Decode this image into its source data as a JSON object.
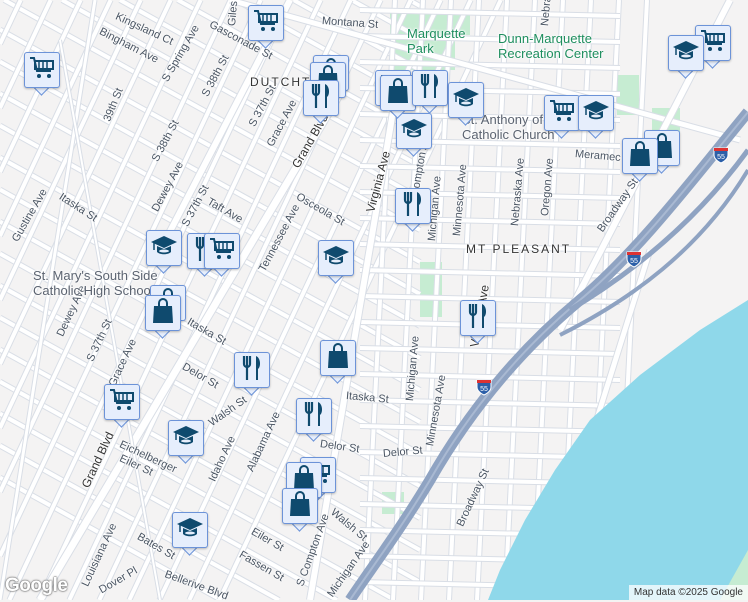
{
  "map": {
    "neighborhoods": [
      "DUTCHTOWN",
      "MT PLEASANT"
    ],
    "pois": [
      {
        "name": "Marquette\nPark",
        "kind": "park"
      },
      {
        "name": "Dunn-Marquette\nRecreation Center",
        "kind": "park"
      },
      {
        "name": "St. Anthony of\nCatholic Church",
        "kind": "church"
      },
      {
        "name": "St. Mary's South Side\nCatholic High School",
        "kind": "school"
      }
    ],
    "streets": [
      "Kingsland Ct",
      "Bingham Ave",
      "Gasconade St",
      "Montana St",
      "S Spring Ave",
      "S 38th St",
      "39th St",
      "S 37th St",
      "Grace Ave",
      "Grand Blvd",
      "S 38th St",
      "Dewey Ave",
      "S 37th St",
      "Taft Ave",
      "Osceola St",
      "Tennessee Ave",
      "Itaska St",
      "Gustine Ave",
      "Virginia Ave",
      "Compton Ave",
      "Michigan Ave",
      "Minnesota Ave",
      "Nebraska Ave",
      "Oregon Ave",
      "Meramec St",
      "Broadway St",
      "Virginia Ave",
      "Itaska St",
      "Dewey Ave",
      "S 37th St",
      "Grace Ave",
      "Delor St",
      "Itaska St",
      "Michigan Ave",
      "Minnesota Ave",
      "Delor St",
      "Delor St",
      "Walsh St",
      "Eichelberger",
      "Eiler St",
      "Alabama Ave",
      "Idaho Ave",
      "Grand Blvd",
      "Bates St",
      "Louisiana Ave",
      "Eiler St",
      "Fassen St",
      "Dover Pl",
      "Bellerive Blvd",
      "S Compton Ave",
      "Michigan Ave",
      "Walsh St",
      "Broadway St",
      "Nebraska Ave",
      "Giles"
    ],
    "highway_shields": [
      "55",
      "55",
      "55"
    ],
    "markers": [
      {
        "type": "cart"
      },
      {
        "type": "cart"
      },
      {
        "type": "school"
      },
      {
        "type": "fork"
      },
      {
        "type": "cart"
      },
      {
        "type": "school"
      },
      {
        "type": "bag"
      },
      {
        "type": "bag"
      },
      {
        "type": "fork"
      },
      {
        "type": "bag"
      },
      {
        "type": "cart"
      },
      {
        "type": "fork"
      },
      {
        "type": "school"
      },
      {
        "type": "cart"
      },
      {
        "type": "bag"
      },
      {
        "type": "bag"
      },
      {
        "type": "school"
      },
      {
        "type": "fork"
      },
      {
        "type": "fork"
      },
      {
        "type": "school"
      },
      {
        "type": "cart"
      },
      {
        "type": "bag"
      },
      {
        "type": "bag"
      },
      {
        "type": "fork"
      },
      {
        "type": "bag"
      },
      {
        "type": "fork"
      },
      {
        "type": "school"
      },
      {
        "type": "cart"
      },
      {
        "type": "school"
      },
      {
        "type": "cart"
      },
      {
        "type": "school"
      },
      {
        "type": "bag"
      },
      {
        "type": "bag"
      }
    ],
    "colors": {
      "land": "#f4f3f3",
      "water": "#8fd8ea",
      "park": "#c6ecd2",
      "highway": "#8fa3c2",
      "marker_icon": "#0f4a6e"
    }
  },
  "attribution": {
    "logo": "Google",
    "text": "Map data ©2025 Google"
  }
}
